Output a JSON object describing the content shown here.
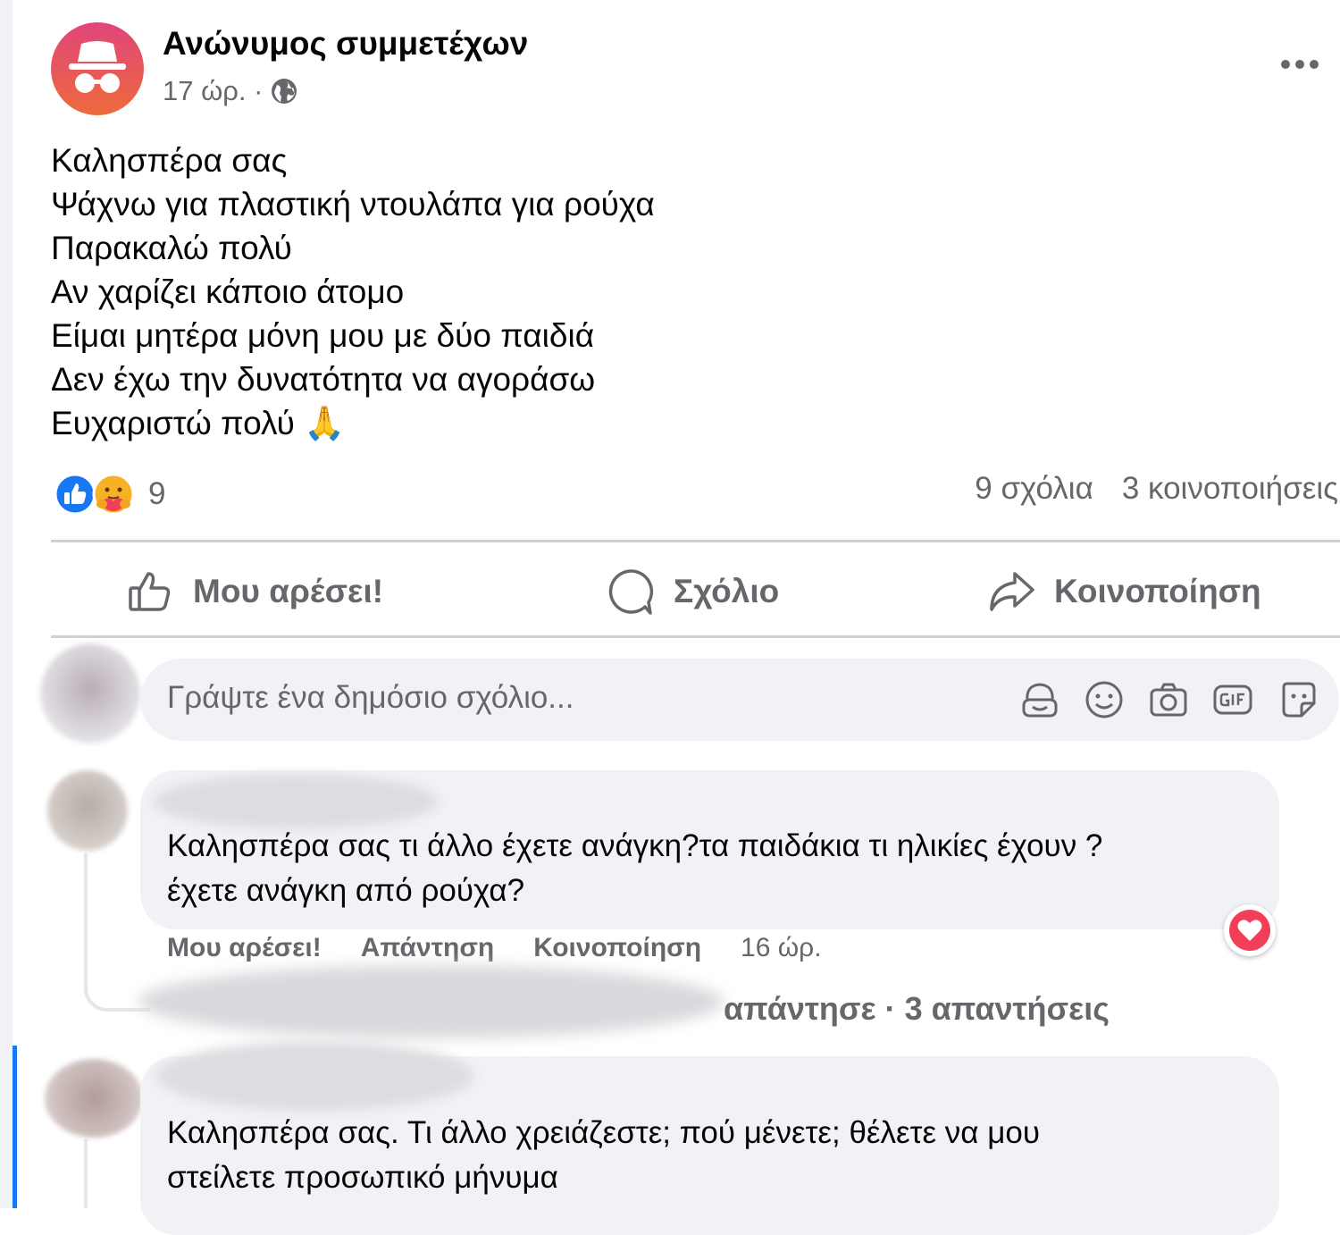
{
  "post": {
    "author": "Ανώνυμος συμμετέχων",
    "time": "17 ώρ. ·",
    "audience_icon": "globe-icon",
    "lines": [
      "Καλησπέρα σας",
      "Ψάχνω για πλαστική ντουλάπα για ρούχα",
      "Παρακαλώ πολύ",
      "Αν χαρίζει κάποιο άτομο",
      "Είμαι μητέρα μόνη μου με δύο παιδιά",
      "Δεν έχω την δυνατότητα να αγοράσω",
      "Ευχαριστώ πολύ"
    ],
    "emoji": "🙏",
    "reaction_icons": [
      "like-reaction-icon",
      "care-reaction-icon"
    ],
    "reaction_count": "9",
    "comments_count": "9 σχόλια",
    "shares_count": "3 κοινοποιήσεις"
  },
  "actions": {
    "like": "Μου αρέσει!",
    "comment": "Σχόλιο",
    "share": "Κοινοποίηση"
  },
  "composer": {
    "placeholder": "Γράψτε ένα δημόσιο σχόλιο...",
    "icons": [
      "avatar-sticker-icon",
      "emoji-icon",
      "camera-icon",
      "gif-icon",
      "sticker-icon"
    ]
  },
  "comments": [
    {
      "line1": "Καλησπέρα σας τι άλλο έχετε ανάγκη?τα παιδάκια τι ηλικίες έχουν ?",
      "line2": "έχετε ανάγκη από ρούχα?",
      "like": "Μου αρέσει!",
      "reply": "Απάντηση",
      "share": "Κοινοποίηση",
      "time": "16 ώρ.",
      "reaction_icon": "heart-icon",
      "replies_summary": "απάντησε · 3 απαντήσεις"
    },
    {
      "line1": "Καλησπέρα σας. Τι άλλο χρειάζεστε; πού μένετε; θέλετε να μου",
      "line2": "στείλετε προσωπικό μήνυμα"
    }
  ],
  "colors": {
    "accent_blue": "#1877f2",
    "secondary_text": "#65676b",
    "bubble": "#f0f2f5",
    "heart": "#f33e58"
  }
}
